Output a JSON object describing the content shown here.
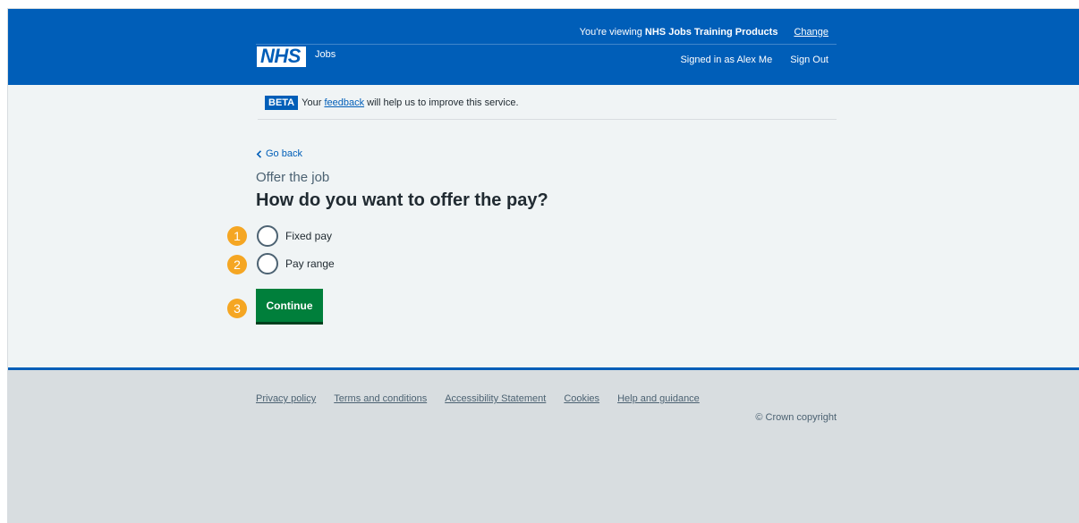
{
  "header": {
    "viewing_prefix": "You're viewing ",
    "viewing_org": "NHS Jobs Training Products",
    "change_link": "Change",
    "logo_text": "NHS",
    "service_name": "Jobs",
    "signed_in": "Signed in as Alex Me",
    "sign_out": "Sign Out"
  },
  "phase_banner": {
    "tag": "BETA",
    "text_before": "Your ",
    "link": "feedback",
    "text_after": " will help us to improve this service."
  },
  "back_link": "Go back",
  "caption": "Offer the job",
  "question": "How do you want to offer the pay?",
  "options": [
    {
      "label": "Fixed pay",
      "checked": false
    },
    {
      "label": "Pay range",
      "checked": false
    }
  ],
  "continue_button": "Continue",
  "markers": [
    "1",
    "2",
    "3"
  ],
  "footer": {
    "links": [
      "Privacy policy",
      "Terms and conditions",
      "Accessibility Statement",
      "Cookies",
      "Help and guidance"
    ],
    "copyright": "© Crown copyright"
  },
  "colors": {
    "nhs_blue": "#005eb8",
    "button_green": "#007f3b",
    "marker_orange": "#f5a623",
    "main_bg": "#f0f4f5",
    "footer_bg": "#d8dde0"
  }
}
